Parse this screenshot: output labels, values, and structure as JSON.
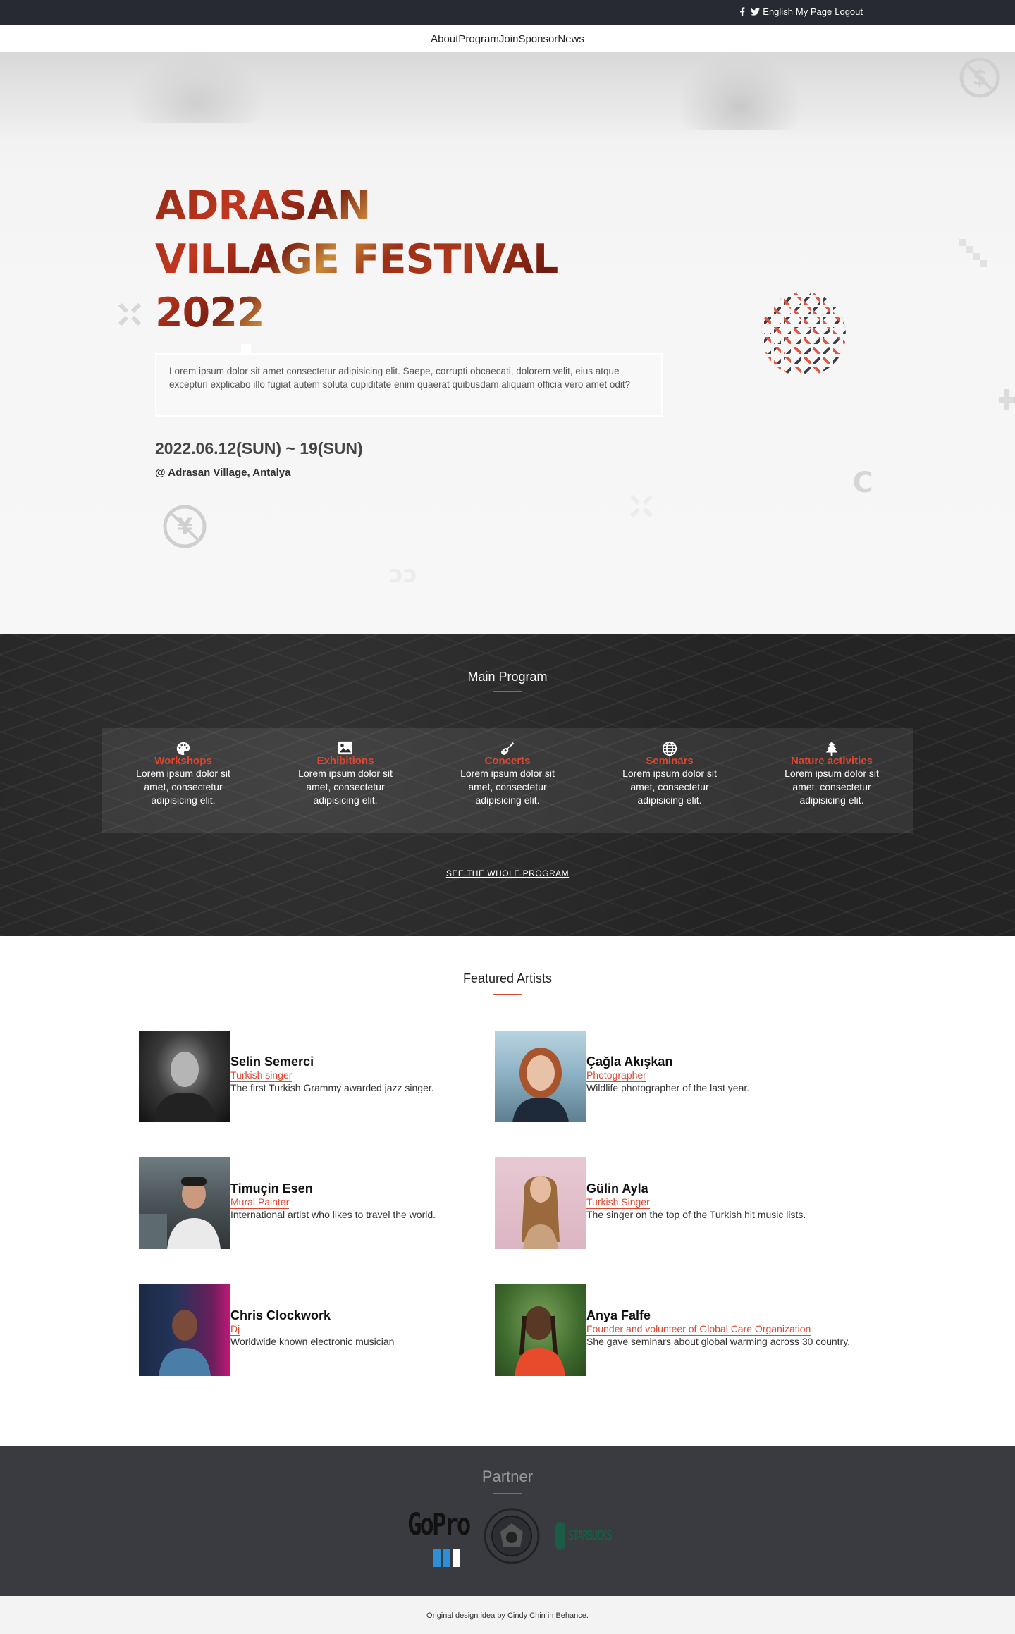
{
  "topbar": {
    "language": "English",
    "my_page": "My Page",
    "logout": "Logout"
  },
  "nav": {
    "items": [
      "About",
      "Program",
      "Join",
      "Sponsor",
      "News"
    ]
  },
  "hero": {
    "title_line1": "ADRASAN",
    "title_line2": "VILLAGE FESTIVAL",
    "title_line3": "2022",
    "description": "Lorem ipsum dolor sit amet consectetur adipisicing elit. Saepe, corrupti obcaecati, dolorem velit, eius atque excepturi explicabo illo fugiat autem soluta cupiditate enim quaerat quibusdam aliquam officia vero amet odit?",
    "date": "2022.06.12(SUN) ~ 19(SUN)",
    "place": "@ Adrasan Village, Antalya"
  },
  "program": {
    "title": "Main Program",
    "cards": [
      {
        "icon": "palette-icon",
        "title": "Workshops",
        "text": "Lorem ipsum dolor sit amet, consectetur adipisicing elit."
      },
      {
        "icon": "image-icon",
        "title": "Exhibitions",
        "text": "Lorem ipsum dolor sit amet, consectetur adipisicing elit."
      },
      {
        "icon": "guitar-icon",
        "title": "Concerts",
        "text": "Lorem ipsum dolor sit amet, consectetur adipisicing elit."
      },
      {
        "icon": "globe-icon",
        "title": "Seminars",
        "text": "Lorem ipsum dolor sit amet, consectetur adipisicing elit."
      },
      {
        "icon": "tree-icon",
        "title": "Nature activities",
        "text": "Lorem ipsum dolor sit amet, consectetur adipisicing elit."
      }
    ],
    "see_all": "SEE THE WHOLE PROGRAM"
  },
  "featured": {
    "title": "Featured Artists",
    "artists": [
      {
        "name": "Selin Semerci",
        "role": "Turkish singer",
        "bio": "The first Turkish Grammy awarded jazz singer."
      },
      {
        "name": "Çağla Akışkan",
        "role": "Photographer",
        "bio": "Wildlife photographer of the last year."
      },
      {
        "name": "Timuçin Esen",
        "role": "Mural Painter",
        "bio": "International artist who likes to travel the world."
      },
      {
        "name": "Gülin Ayla",
        "role": "Turkish Singer",
        "bio": "The singer on the top of the Turkish hit music lists."
      },
      {
        "name": "Chris Clockwork",
        "role": "Dj",
        "bio": "Worldwide known electronic musician"
      },
      {
        "name": "Anya Falfe",
        "role": "Founder and volunteer of Global Care Organization",
        "bio": "She gave seminars about global warming across 30 country."
      }
    ]
  },
  "partner": {
    "title": "Partner",
    "logos": [
      "GoPro",
      "STARBUCKS"
    ]
  },
  "footer": {
    "credit": "Original design idea by Cindy Chin in Behance."
  },
  "colors": {
    "accent": "#e0462f",
    "topbar": "#272a33",
    "partner_bg": "#3a3b40"
  }
}
